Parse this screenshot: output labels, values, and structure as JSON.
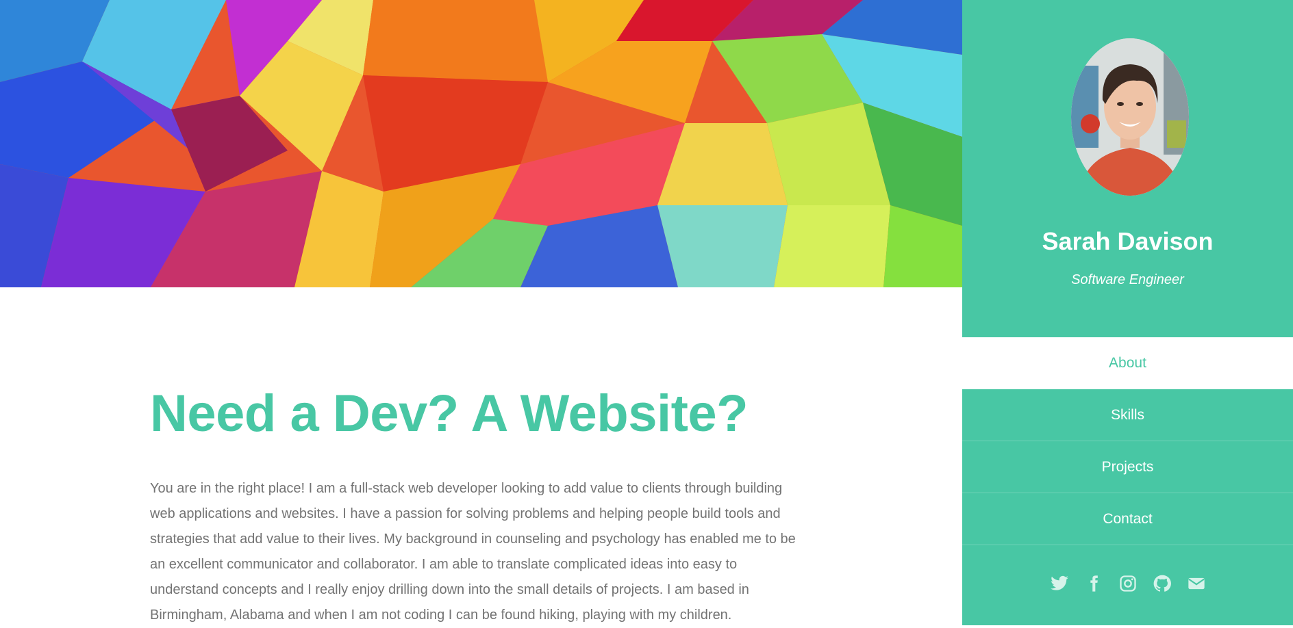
{
  "profile": {
    "name": "Sarah Davison",
    "role": "Software Engineer"
  },
  "nav": {
    "items": [
      {
        "label": "About",
        "active": true
      },
      {
        "label": "Skills",
        "active": false
      },
      {
        "label": "Projects",
        "active": false
      },
      {
        "label": "Contact",
        "active": false
      }
    ]
  },
  "social": {
    "icons": [
      "twitter-icon",
      "facebook-icon",
      "instagram-icon",
      "github-icon",
      "envelope-icon"
    ]
  },
  "about": {
    "headline": "Need a Dev? A Website?",
    "text": "You are in the right place! I am a full-stack web developer looking to add value to clients through building web applications and websites. I have a passion for solving problems and helping people build tools and strategies that add value to their lives. My background in counseling and psychology has enabled me to be an excellent communicator and collaborator. I am able to translate complicated ideas into easy to understand concepts and I really enjoy drilling down into the small details of projects. I am based in Birmingham, Alabama and when I am not coding I can be found hiking, playing with my children."
  },
  "colors": {
    "accent": "#48c7a4",
    "text": "#737373",
    "white": "#ffffff"
  }
}
